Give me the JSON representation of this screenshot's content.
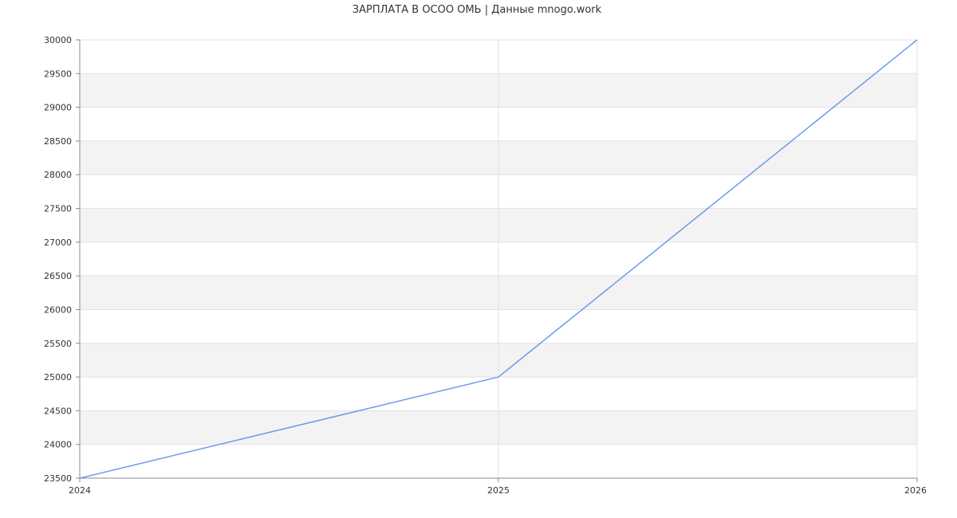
{
  "chart_data": {
    "type": "line",
    "title": "ЗАРПЛАТА В ОСОО ОМЬ | Данные mnogo.work",
    "x": [
      "2024",
      "2025",
      "2026"
    ],
    "series": [
      {
        "values": [
          23500,
          25000,
          30000
        ]
      }
    ],
    "ylim": [
      23500,
      30000
    ],
    "yticks": [
      23500,
      24000,
      24500,
      25000,
      25500,
      26000,
      26500,
      27000,
      27500,
      28000,
      28500,
      29000,
      29500,
      30000
    ],
    "xlabel": "",
    "ylabel": "",
    "grid": true,
    "banded_background": true,
    "colors": {
      "line": "#6b9bea",
      "band": "#f3f3f3",
      "grid": "#e2e2e2",
      "axis": "#888888"
    }
  }
}
